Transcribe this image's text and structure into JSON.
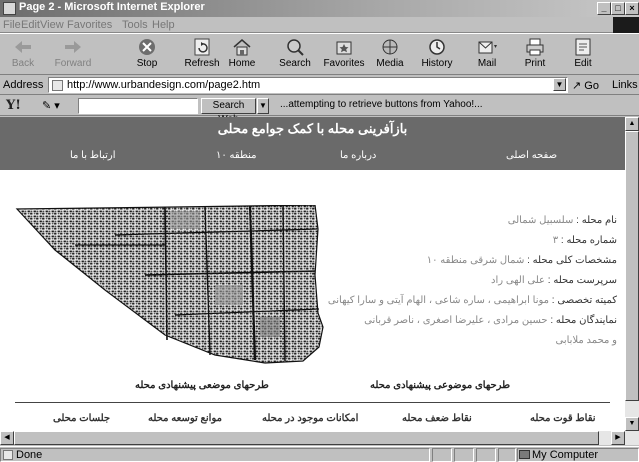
{
  "window": {
    "title": "Page 2 - Microsoft Internet Explorer",
    "controls": [
      "_",
      "□",
      "×"
    ]
  },
  "menu": [
    "File",
    "Edit",
    "View",
    "Favorites",
    "Tools",
    "Help"
  ],
  "toolbar": [
    {
      "label": "Back",
      "icon": "back-arrow-icon",
      "enabled": false
    },
    {
      "label": "Forward",
      "icon": "forward-arrow-icon",
      "enabled": false
    },
    {
      "label": "Stop",
      "icon": "stop-icon",
      "enabled": true
    },
    {
      "label": "Refresh",
      "icon": "refresh-icon",
      "enabled": true
    },
    {
      "label": "Home",
      "icon": "home-icon",
      "enabled": true
    },
    {
      "label": "Search",
      "icon": "search-icon",
      "enabled": true
    },
    {
      "label": "Favorites",
      "icon": "favorites-icon",
      "enabled": true
    },
    {
      "label": "Media",
      "icon": "media-icon",
      "enabled": true
    },
    {
      "label": "History",
      "icon": "history-icon",
      "enabled": true
    },
    {
      "label": "Mail",
      "icon": "mail-icon",
      "enabled": true
    },
    {
      "label": "Print",
      "icon": "print-icon",
      "enabled": true
    },
    {
      "label": "Edit",
      "icon": "edit-icon",
      "enabled": true
    }
  ],
  "address": {
    "label": "Address",
    "url": "http://www.urbandesign.com/page2.htm",
    "go": "Go",
    "links": "Links"
  },
  "yahoo": {
    "logo": "Y!",
    "search_value": "",
    "search_button": "Search Web",
    "message": "...attempting to retrieve buttons from Yahoo!..."
  },
  "page": {
    "site_title": "بازآفرینی محله با کمک جوامع محلی",
    "nav": {
      "home": "صفحه اصلی",
      "about": "درباره ما",
      "region": "منطقه ۱۰",
      "contact": "ارتباط با ما"
    },
    "info": [
      {
        "key": "نام محله :",
        "value": "سلسبیل شمالی"
      },
      {
        "key": "شماره محله :",
        "value": "۳"
      },
      {
        "key": "مشخصات کلی محله :",
        "value": "شمال شرقی منطقه ۱۰"
      },
      {
        "key": "سرپرست محله :",
        "value": "علی الهی راد"
      },
      {
        "key": "کمیته تخصصی :",
        "value": "مونا ابراهیمی ، ساره شاعی ، الهام آیتی و سارا کیهانی"
      },
      {
        "key": "نمایندگان محله :",
        "value": "حسین مرادی ، علیرضا اصغری ، ناصر قربانی"
      },
      {
        "key": "",
        "value": "و محمد ملابابی"
      }
    ],
    "captions": {
      "right": "طرحهای موضوعی پیشنهادی محله",
      "left": "طرحهای موضعی پیشنهادی محله"
    },
    "bottom_nav": {
      "strengths": "نقاط قوت محله",
      "weaknesses": "نقاط ضعف محله",
      "facilities": "امکانات موجود در محله",
      "obstacles": "موانع توسعه محله",
      "meetings": "جلسات محلی"
    }
  },
  "status": {
    "text": "Done",
    "zone": "My Computer"
  },
  "colors": {
    "banner": "#6a6a6a",
    "chrome": "#c0c0c0"
  }
}
